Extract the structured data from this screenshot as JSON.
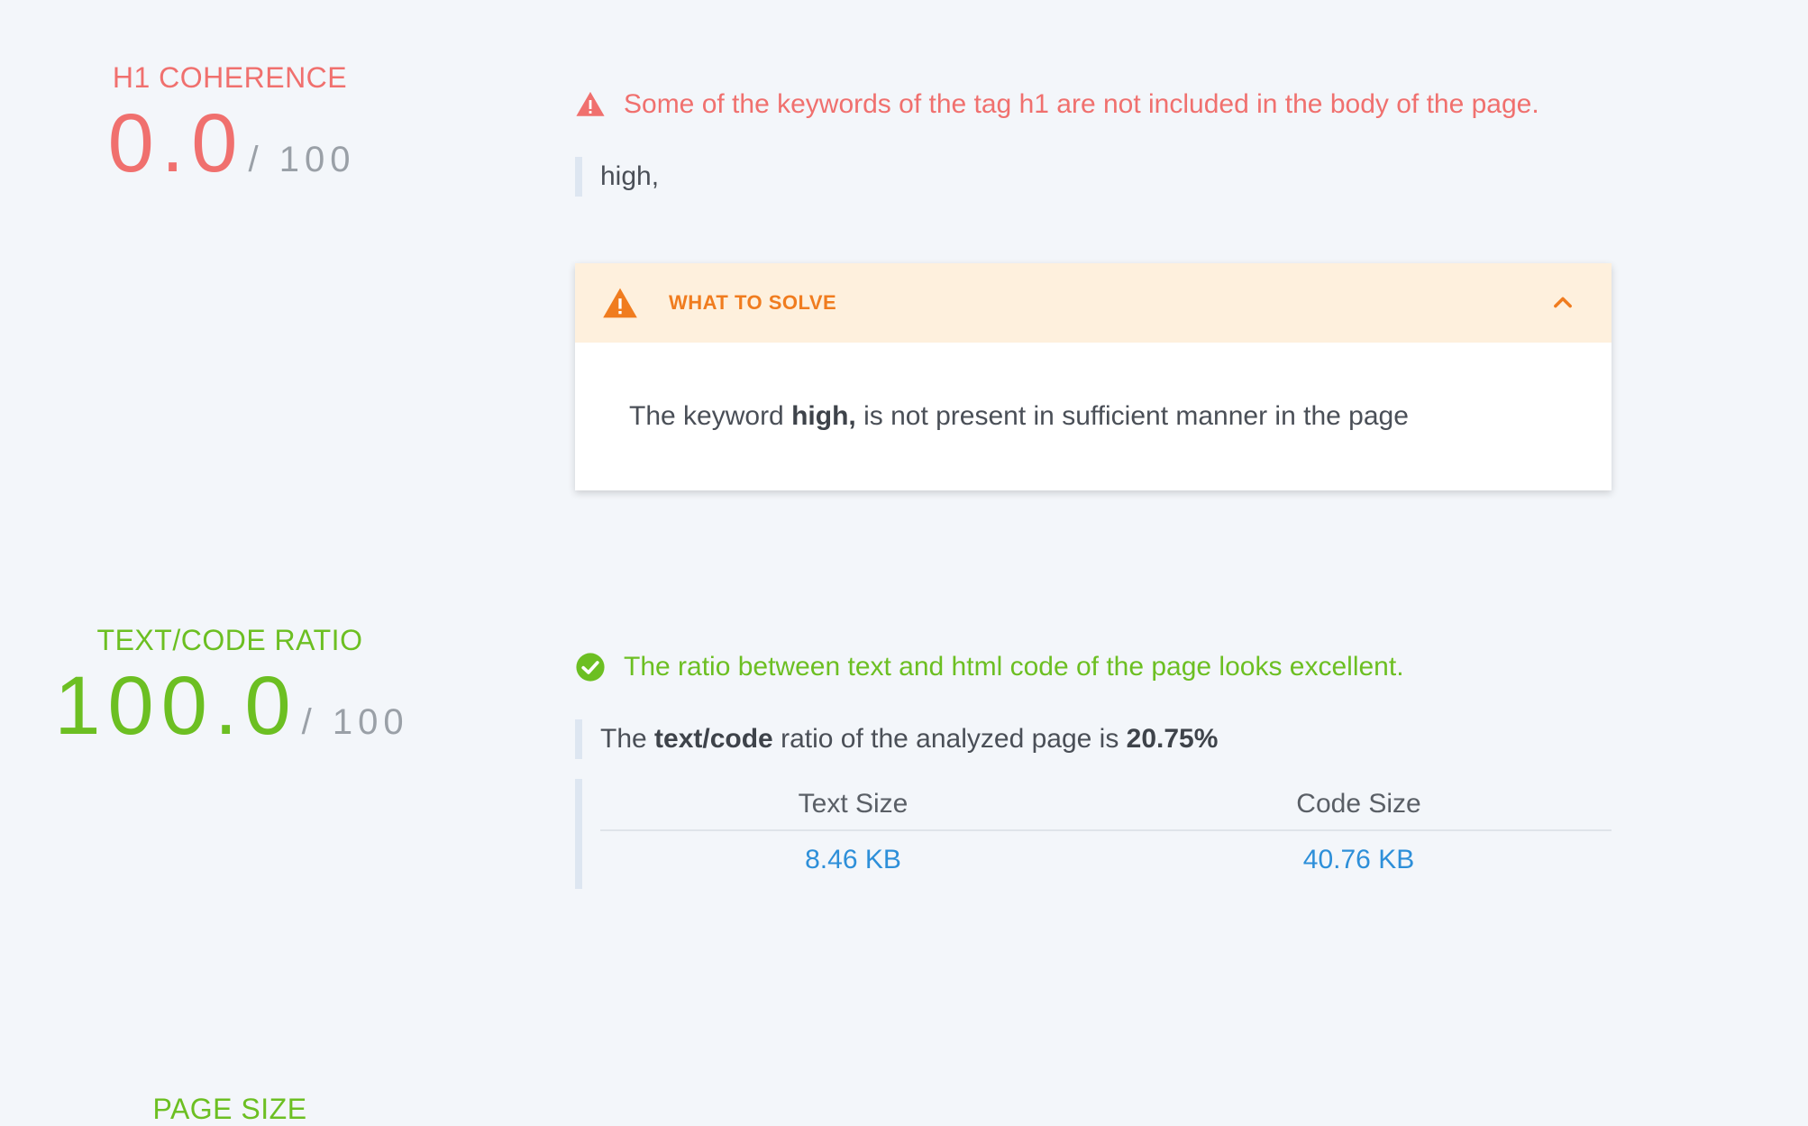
{
  "h1_coherence": {
    "title": "H1 COHERENCE",
    "score": "0.0",
    "score_max": "/ 100",
    "status_message": "Some of the keywords of the tag h1 are not included in the body of the page.",
    "keywords": "high,",
    "solve": {
      "title": "WHAT TO SOLVE",
      "body_prefix": "The keyword ",
      "body_keyword": "high,",
      "body_suffix": " is not present in sufficient manner in the page"
    }
  },
  "text_code_ratio": {
    "title": "TEXT/CODE RATIO",
    "score": "100.0",
    "score_max": "/ 100",
    "status_message": "The ratio between text and html code of the page looks excellent.",
    "ratio_prefix": "The ",
    "ratio_term": "text/code",
    "ratio_middle": " ratio of the analyzed page is ",
    "ratio_value": "20.75%",
    "table": {
      "headers": [
        "Text Size",
        "Code Size"
      ],
      "values": [
        "8.46 KB",
        "40.76 KB"
      ]
    }
  },
  "page_size": {
    "title": "PAGE SIZE"
  },
  "colors": {
    "error": "#f0706e",
    "success": "#6cbf22",
    "warning": "#f07c1f",
    "warning_bg": "#fef0dd",
    "link": "#2d8fd9",
    "background": "#f3f6fa"
  },
  "icons": {
    "error": "warning-triangle-icon",
    "warning": "warning-triangle-icon",
    "success": "check-circle-icon",
    "collapse": "chevron-up-icon"
  }
}
